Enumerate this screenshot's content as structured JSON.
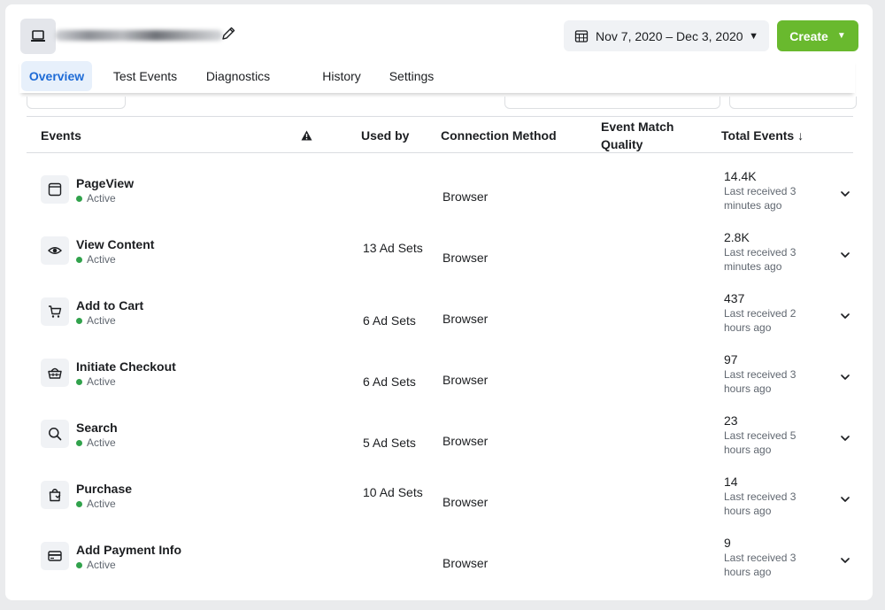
{
  "header": {
    "source_icon": "laptop-icon",
    "edit_icon": "pencil-icon",
    "date_range": "Nov 7, 2020 – Dec 3, 2020",
    "create_label": "Create",
    "brand_color": "#69b92e"
  },
  "tabs": [
    {
      "label": "Overview",
      "active": true
    },
    {
      "label": "Test Events",
      "active": false
    },
    {
      "label": "Diagnostics",
      "active": false
    },
    {
      "label": "History",
      "active": false
    },
    {
      "label": "Settings",
      "active": false
    }
  ],
  "table": {
    "headers": {
      "events": "Events",
      "warning_icon": "warning-icon",
      "used_by": "Used by",
      "connection_method": "Connection Method",
      "event_match_quality": "Event Match Quality",
      "total_events": "Total Events ↓"
    },
    "rows": [
      {
        "icon": "browser-window-icon",
        "name": "PageView",
        "status": "Active",
        "used_by": "",
        "method": "Browser",
        "count": "14.4K",
        "received": "Last received 3 minutes ago"
      },
      {
        "icon": "eye-icon",
        "name": "View Content",
        "status": "Active",
        "used_by": "13 Ad Sets",
        "method": "Browser",
        "count": "2.8K",
        "received": "Last received 3 minutes ago"
      },
      {
        "icon": "cart-icon",
        "name": "Add to Cart",
        "status": "Active",
        "used_by": "6 Ad Sets",
        "method": "Browser",
        "count": "437",
        "received": "Last received 2 hours ago"
      },
      {
        "icon": "basket-icon",
        "name": "Initiate Checkout",
        "status": "Active",
        "used_by": "6 Ad Sets",
        "method": "Browser",
        "count": "97",
        "received": "Last received 3 hours ago"
      },
      {
        "icon": "search-icon",
        "name": "Search",
        "status": "Active",
        "used_by": "5 Ad Sets",
        "method": "Browser",
        "count": "23",
        "received": "Last received 5 hours ago"
      },
      {
        "icon": "shopping-bag-icon",
        "name": "Purchase",
        "status": "Active",
        "used_by": "10 Ad Sets",
        "method": "Browser",
        "count": "14",
        "received": "Last received 3 hours ago"
      },
      {
        "icon": "credit-card-icon",
        "name": "Add Payment Info",
        "status": "Active",
        "used_by": "",
        "method": "Browser",
        "count": "9",
        "received": "Last received 3 hours ago"
      }
    ]
  },
  "colors": {
    "active_tab_text": "#1e6bd6",
    "active_tab_bg": "#e7f0fb",
    "status_active": "#31a24c"
  }
}
